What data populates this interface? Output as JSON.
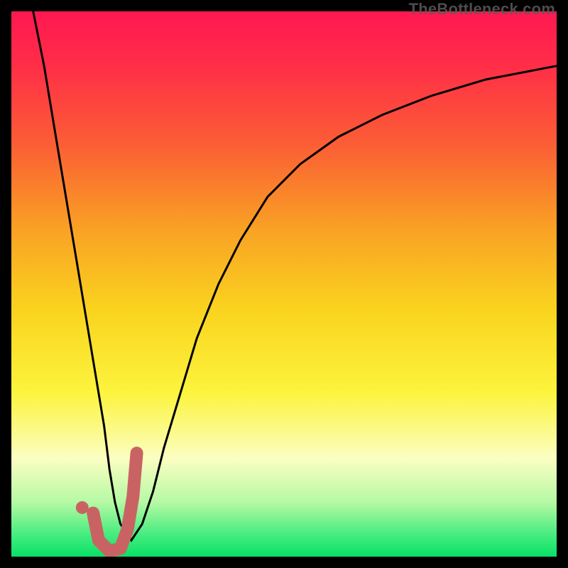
{
  "watermark": "TheBottleneck.com",
  "chart_data": {
    "type": "line",
    "title": "",
    "xlabel": "",
    "ylabel": "",
    "xlim": [
      0,
      100
    ],
    "ylim": [
      0,
      100
    ],
    "grid": false,
    "background_gradient": [
      {
        "stop": 0.0,
        "color": "#ff1851"
      },
      {
        "stop": 0.1,
        "color": "#ff2e47"
      },
      {
        "stop": 0.25,
        "color": "#fb6034"
      },
      {
        "stop": 0.4,
        "color": "#f9a224"
      },
      {
        "stop": 0.55,
        "color": "#fad41e"
      },
      {
        "stop": 0.7,
        "color": "#fcf43e"
      },
      {
        "stop": 0.82,
        "color": "#fbfec2"
      },
      {
        "stop": 0.9,
        "color": "#b6f9a4"
      },
      {
        "stop": 0.96,
        "color": "#45ec7f"
      },
      {
        "stop": 1.0,
        "color": "#08e166"
      }
    ],
    "series": [
      {
        "name": "bottleneck-curve",
        "stroke": "#000000",
        "stroke_width": 3,
        "x": [
          4,
          6,
          8,
          10,
          12,
          13.5,
          15,
          17,
          18,
          19,
          20,
          22,
          24,
          26,
          28,
          31,
          34,
          38,
          42,
          47,
          53,
          60,
          68,
          77,
          87,
          100
        ],
        "y": [
          100,
          90,
          78,
          66,
          54,
          45,
          36,
          24,
          16,
          10,
          6,
          3,
          6,
          12,
          20,
          30,
          40,
          50,
          58,
          66,
          72,
          77,
          81,
          84.5,
          87.5,
          90
        ]
      }
    ],
    "markers": [
      {
        "name": "highlight-j-stroke",
        "stroke": "#c96363",
        "stroke_width": 18,
        "linecap": "round",
        "x": [
          15,
          16,
          18,
          20,
          21.3,
          22.3,
          23
        ],
        "y": [
          8,
          3,
          1,
          1.5,
          5,
          11,
          19
        ]
      },
      {
        "name": "highlight-dot",
        "fill": "#c96363",
        "cx": 13,
        "cy": 9,
        "r": 9
      }
    ]
  }
}
